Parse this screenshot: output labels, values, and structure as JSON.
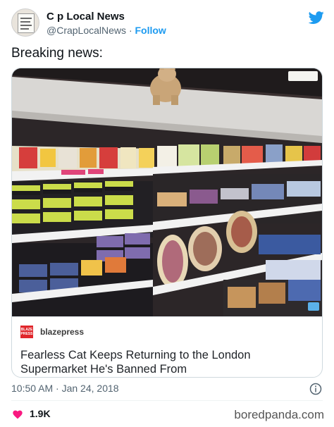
{
  "author": {
    "display_name": "C  p Local News",
    "handle": "@CrapLocalNews",
    "separator": "·",
    "follow_label": "Follow"
  },
  "tweet": {
    "text": "Breaking news:",
    "timestamp": "10:50 AM · Jan 24, 2018",
    "likes": "1.9K"
  },
  "link_card": {
    "source": "blazepress",
    "source_logo_text": "BLAZE PRESS",
    "title": "Fearless Cat Keeps Returning to the London Supermarket He's Banned From"
  },
  "watermark": "boredpanda.com",
  "colors": {
    "twitter_blue": "#1d9bf0",
    "like_pink": "#f91880",
    "source_red": "#e0262b",
    "text_secondary": "#536471"
  },
  "icons": [
    "twitter-bird-icon",
    "info-icon",
    "heart-icon"
  ]
}
